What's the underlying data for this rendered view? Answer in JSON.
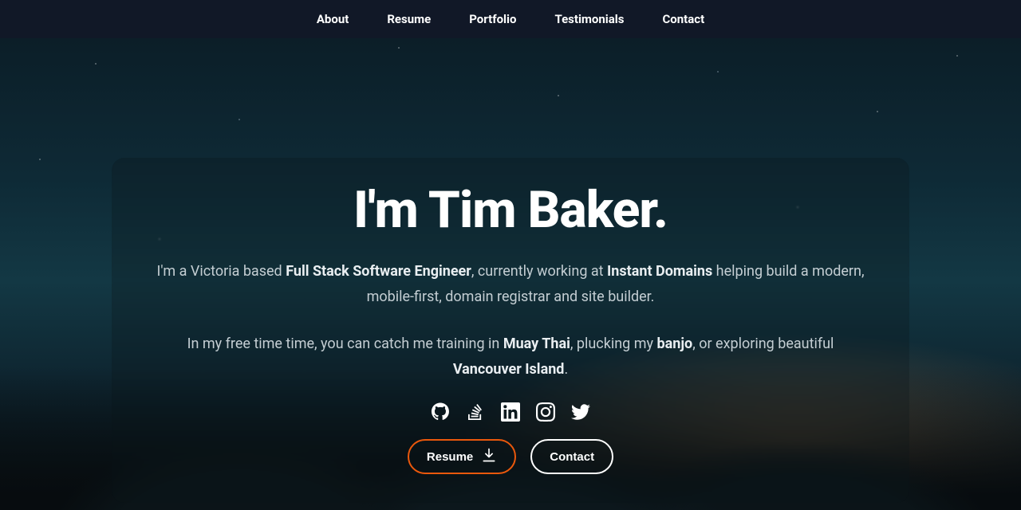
{
  "nav": {
    "items": [
      "About",
      "Resume",
      "Portfolio",
      "Testimonials",
      "Contact"
    ]
  },
  "hero": {
    "title": "I'm Tim Baker.",
    "p1": {
      "t0": "I'm a Victoria based ",
      "s0": "Full Stack Software Engineer",
      "t1": ", currently working at ",
      "s1": "Instant Domains",
      "t2": " helping build a modern, mobile-first, domain registrar and site builder."
    },
    "p2": {
      "t0": "In my free time time, you can catch me training in ",
      "s0": "Muay Thai",
      "t1": ", plucking my ",
      "s1": "banjo",
      "t2": ", or exploring beautiful ",
      "s2": "Vancouver Island",
      "t3": "."
    },
    "socials": [
      "github",
      "stackoverflow",
      "linkedin",
      "instagram",
      "twitter"
    ],
    "resume_label": "Resume",
    "contact_label": "Contact"
  },
  "colors": {
    "accent": "#ea580c",
    "nav_bg": "#111827"
  }
}
